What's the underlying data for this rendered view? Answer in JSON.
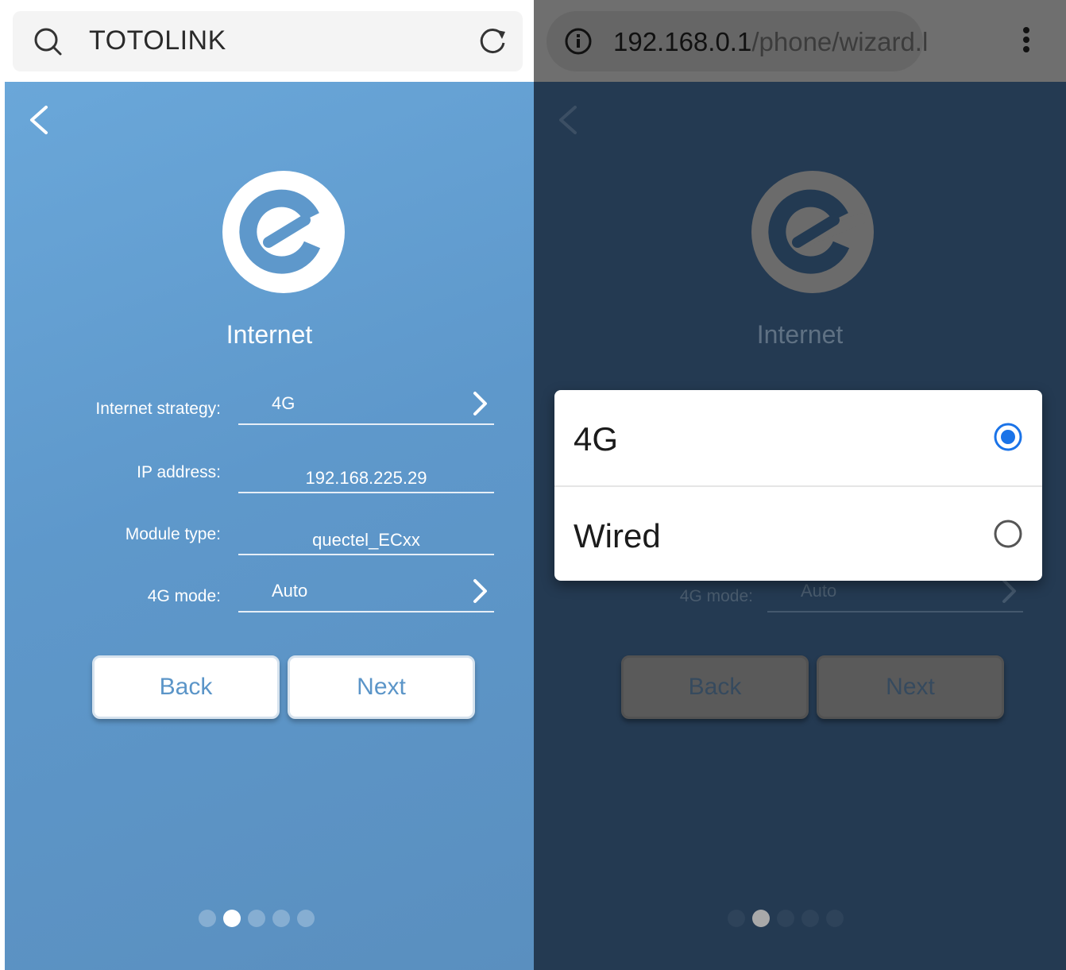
{
  "left": {
    "search_bar": {
      "site": "TOTOLINK"
    },
    "title": "Internet",
    "fields": {
      "strategy": {
        "label": "Internet strategy:",
        "value": "4G"
      },
      "ip": {
        "label": "IP address:",
        "value": "192.168.225.29"
      },
      "module": {
        "label": "Module type:",
        "value": "quectel_ECxx"
      },
      "mode": {
        "label": "4G mode:",
        "value": "Auto"
      }
    },
    "buttons": {
      "back": "Back",
      "next": "Next"
    },
    "pager": {
      "total": 5,
      "current": 2
    }
  },
  "right": {
    "address_bar": {
      "host": "192.168.0.1",
      "path": "/phone/wizard.l"
    },
    "title": "Internet",
    "dialog": {
      "options": [
        {
          "label": "4G",
          "selected": true
        },
        {
          "label": "Wired",
          "selected": false
        }
      ]
    },
    "fields": {
      "mode": {
        "label": "4G mode:",
        "value": "Auto"
      }
    },
    "buttons": {
      "back": "Back",
      "next": "Next"
    },
    "pager": {
      "total": 5,
      "current": 2
    }
  },
  "colors": {
    "accent_blue": "#5e98cb",
    "radio_selected": "#1a73e8",
    "overlay_dark": "#243a52"
  },
  "icons": {
    "search": "search-icon",
    "reload": "reload-icon",
    "info": "info-icon",
    "menu": "more-vert-icon",
    "back": "chevron-left-icon",
    "chevron": "chevron-right-icon",
    "logo": "totolink-e-logo"
  }
}
